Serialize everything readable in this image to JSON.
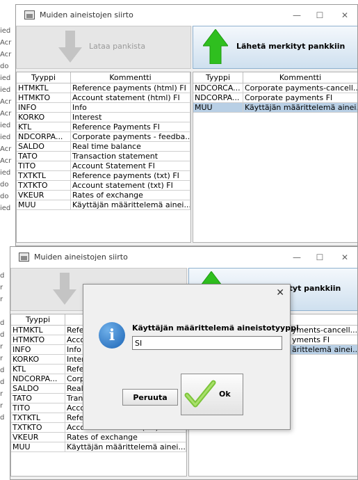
{
  "background_strip_1": [
    "ied",
    "Acr",
    "Acr",
    "do",
    "ied",
    "ied",
    "Acr",
    "Acr",
    "ied",
    "ied",
    "Acr",
    "Acr",
    "ied",
    "do",
    "do",
    "ied"
  ],
  "background_strip_2": [
    "d",
    "r",
    "r",
    "",
    "d",
    "d",
    "r",
    "r",
    "d",
    "d",
    "r",
    "r",
    "d",
    "",
    "",
    ""
  ],
  "window": {
    "title": "Muiden aineistojen siirto",
    "minimize": "—",
    "maximize": "☐",
    "close": "✕"
  },
  "toolbar": {
    "download_label": "Lataa pankista",
    "upload_label": "Lähetä merkityt pankkiin"
  },
  "left_table": {
    "headers": [
      "Tyyppi",
      "Kommentti"
    ],
    "rows": [
      {
        "type": "HTMKTL",
        "comment": "Reference payments (html) FI"
      },
      {
        "type": "HTMKTO",
        "comment": "Account statement (html) FI"
      },
      {
        "type": "INFO",
        "comment": "Info"
      },
      {
        "type": "KORKO",
        "comment": "Interest"
      },
      {
        "type": "KTL",
        "comment": "Reference Payments FI"
      },
      {
        "type": "NDCORPA...",
        "comment": "Corporate payments - feedba..."
      },
      {
        "type": "SALDO",
        "comment": "Real time balance"
      },
      {
        "type": "TATO",
        "comment": "Transaction statement"
      },
      {
        "type": "TITO",
        "comment": "Account Statement FI"
      },
      {
        "type": "TXTKTL",
        "comment": "Reference payments (txt) FI"
      },
      {
        "type": "TXTKTO",
        "comment": "Account statement (txt) FI"
      },
      {
        "type": "VKEUR",
        "comment": "Rates of exchange"
      },
      {
        "type": "MUU",
        "comment": "Käyttäjän määrittelemä ainei..."
      }
    ]
  },
  "right_table": {
    "headers": [
      "Tyyppi",
      "Kommentti"
    ],
    "rows": [
      {
        "type": "NDCORCA...",
        "comment": "Corporate payments-cancell..."
      },
      {
        "type": "NDCORPA...",
        "comment": "Corporate payments FI"
      },
      {
        "type": "MUU",
        "comment": "Käyttäjän määrittelemä ainei...",
        "selected": true
      }
    ]
  },
  "right_table_2": {
    "header": "mmentti",
    "rows": [
      "yments-cancell...",
      "yments FI",
      "ärittelemä ainei..."
    ]
  },
  "dialog": {
    "close": "✕",
    "message": "Käyttäjän määrittelemä aineistotyyppi",
    "input_value": "SI",
    "cancel_label": "Peruuta",
    "ok_label": "Ok"
  },
  "colors": {
    "selected_row": "#b8cfe5",
    "arrow_green": "#2fbf1f",
    "info_blue": "#1c64b5"
  }
}
